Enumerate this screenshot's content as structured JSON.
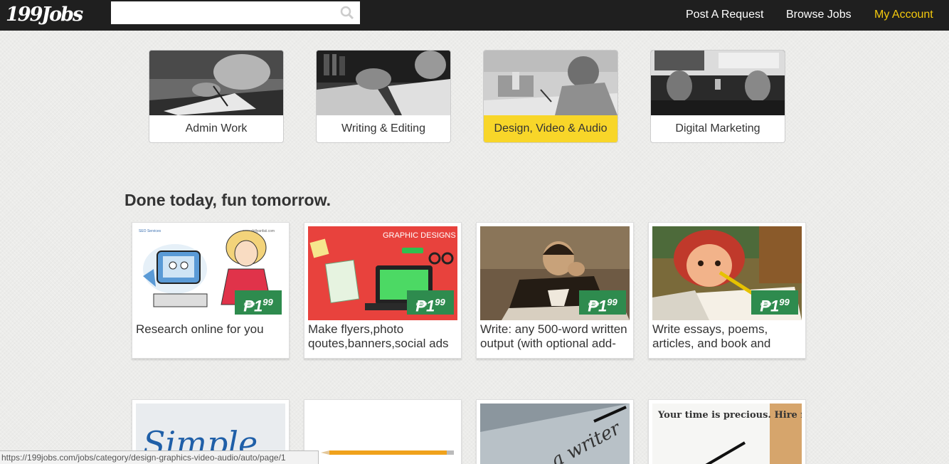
{
  "header": {
    "logo": "199Jobs",
    "search_placeholder": "",
    "nav": [
      {
        "label": "Post A Request"
      },
      {
        "label": "Browse Jobs"
      },
      {
        "label": "My Account",
        "active": true
      }
    ],
    "accent_color": "#f4c90d"
  },
  "categories": [
    {
      "label": "Admin Work",
      "selected": false
    },
    {
      "label": "Writing & Editing",
      "selected": false
    },
    {
      "label": "Design, Video & Audio",
      "selected": true
    },
    {
      "label": "Digital Marketing",
      "selected": false
    }
  ],
  "section": {
    "title": "Done today, fun tomorrow."
  },
  "jobs": [
    {
      "price_symbol": "₱",
      "price": "1",
      "price_sup": "99",
      "title": "Research online for you"
    },
    {
      "price_symbol": "₱",
      "price": "1",
      "price_sup": "99",
      "title": "Make flyers,photo qoutes,banners,social ads"
    },
    {
      "price_symbol": "₱",
      "price": "1",
      "price_sup": "99",
      "title": "Write: any 500-word written output (with optional add-"
    },
    {
      "price_symbol": "₱",
      "price": "1",
      "price_sup": "99",
      "title": "Write essays, poems, articles, and book and"
    }
  ],
  "jobs_row2_images": [
    {
      "caption": "Simple"
    },
    {
      "caption": ""
    },
    {
      "caption": "a writer"
    },
    {
      "caption": "Your time is precious. Hire me!"
    }
  ],
  "card1_thumb": {
    "header": "SEO Services",
    "url": "www.dollyanfaii.com"
  },
  "card2_thumb": {
    "banner": "GRAPHIC DESIGNS"
  },
  "status_url": "https://199jobs.com/jobs/category/design-graphics-video-audio/auto/page/1"
}
